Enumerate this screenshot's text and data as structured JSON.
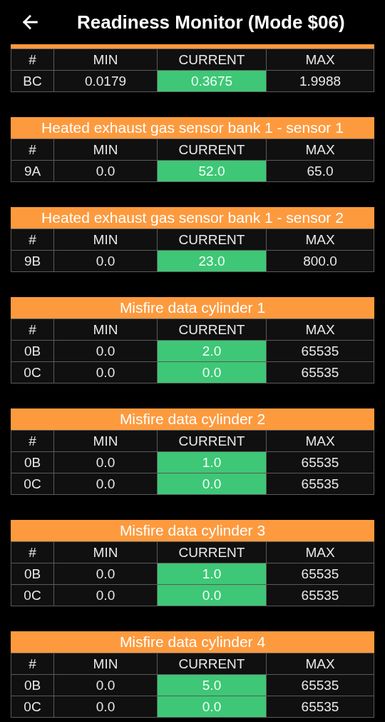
{
  "app_bar": {
    "title": "Readiness Monitor (Mode $06)"
  },
  "sections": [
    {
      "columns": [
        "#",
        "MIN",
        "CURRENT",
        "MAX"
      ],
      "rows": [
        {
          "id": "BC",
          "min": "0.0179",
          "current": "0.3675",
          "max": "1.9988",
          "pass": true
        }
      ]
    },
    {
      "title": "Heated exhaust gas sensor bank 1 - sensor 1",
      "columns": [
        "#",
        "MIN",
        "CURRENT",
        "MAX"
      ],
      "rows": [
        {
          "id": "9A",
          "min": "0.0",
          "current": "52.0",
          "max": "65.0",
          "pass": true
        }
      ]
    },
    {
      "title": "Heated exhaust gas sensor bank 1 - sensor 2",
      "columns": [
        "#",
        "MIN",
        "CURRENT",
        "MAX"
      ],
      "rows": [
        {
          "id": "9B",
          "min": "0.0",
          "current": "23.0",
          "max": "800.0",
          "pass": true
        }
      ]
    },
    {
      "title": "Misfire data cylinder 1",
      "columns": [
        "#",
        "MIN",
        "CURRENT",
        "MAX"
      ],
      "rows": [
        {
          "id": "0B",
          "min": "0.0",
          "current": "2.0",
          "max": "65535",
          "pass": true
        },
        {
          "id": "0C",
          "min": "0.0",
          "current": "0.0",
          "max": "65535",
          "pass": true
        }
      ]
    },
    {
      "title": "Misfire data cylinder 2",
      "columns": [
        "#",
        "MIN",
        "CURRENT",
        "MAX"
      ],
      "rows": [
        {
          "id": "0B",
          "min": "0.0",
          "current": "1.0",
          "max": "65535",
          "pass": true
        },
        {
          "id": "0C",
          "min": "0.0",
          "current": "0.0",
          "max": "65535",
          "pass": true
        }
      ]
    },
    {
      "title": "Misfire data cylinder 3",
      "columns": [
        "#",
        "MIN",
        "CURRENT",
        "MAX"
      ],
      "rows": [
        {
          "id": "0B",
          "min": "0.0",
          "current": "1.0",
          "max": "65535",
          "pass": true
        },
        {
          "id": "0C",
          "min": "0.0",
          "current": "0.0",
          "max": "65535",
          "pass": true
        }
      ]
    },
    {
      "title": "Misfire data cylinder 4",
      "columns": [
        "#",
        "MIN",
        "CURRENT",
        "MAX"
      ],
      "rows": [
        {
          "id": "0B",
          "min": "0.0",
          "current": "5.0",
          "max": "65535",
          "pass": true
        },
        {
          "id": "0C",
          "min": "0.0",
          "current": "0.0",
          "max": "65535",
          "pass": true
        }
      ]
    }
  ]
}
